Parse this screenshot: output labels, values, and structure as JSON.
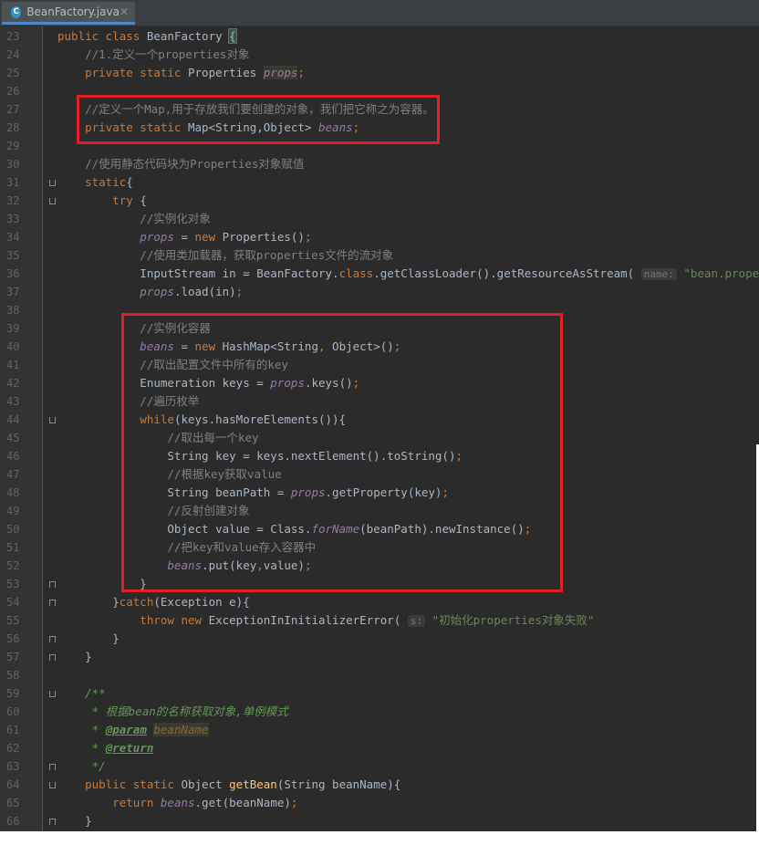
{
  "tab": {
    "icon": "C",
    "filename": "BeanFactory.java",
    "close": "✕"
  },
  "lines": [
    {
      "n": "23",
      "parts": [
        [
          "kw",
          "public class "
        ],
        [
          "",
          "BeanFactory "
        ],
        [
          "bh",
          "{"
        ]
      ]
    },
    {
      "n": "24",
      "parts": [
        [
          "cm",
          "    //1.定义一个properties对象"
        ]
      ]
    },
    {
      "n": "25",
      "parts": [
        [
          "kw",
          "    private static "
        ],
        [
          "",
          "Properties "
        ],
        [
          "fldu",
          "props"
        ],
        [
          "kw",
          ";"
        ]
      ]
    },
    {
      "n": "26",
      "parts": []
    },
    {
      "n": "27",
      "parts": [
        [
          "cm",
          "    //定义一个Map,用于存放我们要创建的对象，我们把它称之为容器。"
        ]
      ]
    },
    {
      "n": "28",
      "parts": [
        [
          "kw",
          "    private static "
        ],
        [
          "",
          "Map<String,Object> "
        ],
        [
          "fld",
          "beans"
        ],
        [
          "kw",
          ";"
        ]
      ]
    },
    {
      "n": "29",
      "parts": []
    },
    {
      "n": "30",
      "parts": [
        [
          "cm",
          "    //使用静态代码块为Properties对象赋值"
        ]
      ]
    },
    {
      "n": "31",
      "parts": [
        [
          "kw",
          "    static"
        ],
        [
          "",
          "{"
        ]
      ]
    },
    {
      "n": "32",
      "parts": [
        [
          "kw",
          "        try "
        ],
        [
          "",
          "{"
        ]
      ]
    },
    {
      "n": "33",
      "parts": [
        [
          "cm",
          "            //实例化对象"
        ]
      ]
    },
    {
      "n": "34",
      "parts": [
        [
          "fld",
          "            props"
        ],
        [
          "",
          " = "
        ],
        [
          "kw",
          "new "
        ],
        [
          "",
          "Properties()"
        ],
        [
          "kw",
          ";"
        ]
      ]
    },
    {
      "n": "35",
      "parts": [
        [
          "cm",
          "            //使用类加载器，获取properties文件的流对象"
        ]
      ]
    },
    {
      "n": "36",
      "parts": [
        [
          "",
          "            InputStream in = BeanFactory."
        ],
        [
          "kw",
          "class"
        ],
        [
          "",
          ".getClassLoader().getResourceAsStream( "
        ],
        [
          "hint",
          "name:"
        ],
        [
          "str",
          " \"bean.properties\""
        ],
        [
          "kw",
          ");"
        ]
      ]
    },
    {
      "n": "37",
      "parts": [
        [
          "fld",
          "            props"
        ],
        [
          "",
          ".load(in)"
        ],
        [
          "kw",
          ";"
        ]
      ]
    },
    {
      "n": "38",
      "parts": []
    },
    {
      "n": "39",
      "parts": [
        [
          "cm",
          "            //实例化容器"
        ]
      ]
    },
    {
      "n": "40",
      "parts": [
        [
          "fld",
          "            beans"
        ],
        [
          "",
          " = "
        ],
        [
          "kw",
          "new "
        ],
        [
          "",
          "HashMap<String"
        ],
        [
          "kw",
          ", "
        ],
        [
          "",
          "Object>()"
        ],
        [
          "kw",
          ";"
        ]
      ]
    },
    {
      "n": "41",
      "parts": [
        [
          "cm",
          "            //取出配置文件中所有的key"
        ]
      ]
    },
    {
      "n": "42",
      "parts": [
        [
          "",
          "            Enumeration keys = "
        ],
        [
          "fld",
          "props"
        ],
        [
          "",
          ".keys()"
        ],
        [
          "kw",
          ";"
        ]
      ]
    },
    {
      "n": "43",
      "parts": [
        [
          "cm",
          "            //遍历枚举"
        ]
      ]
    },
    {
      "n": "44",
      "parts": [
        [
          "kw",
          "            while"
        ],
        [
          "",
          "(keys.hasMoreElements()){"
        ]
      ]
    },
    {
      "n": "45",
      "parts": [
        [
          "cm",
          "                //取出每一个key"
        ]
      ]
    },
    {
      "n": "46",
      "parts": [
        [
          "",
          "                String key = keys.nextElement().toString()"
        ],
        [
          "kw",
          ";"
        ]
      ]
    },
    {
      "n": "47",
      "parts": [
        [
          "cm",
          "                //根据key获取value"
        ]
      ]
    },
    {
      "n": "48",
      "parts": [
        [
          "",
          "                String beanPath = "
        ],
        [
          "fld",
          "props"
        ],
        [
          "",
          ".getProperty(key)"
        ],
        [
          "kw",
          ";"
        ]
      ]
    },
    {
      "n": "49",
      "parts": [
        [
          "cm",
          "                //反射创建对象"
        ]
      ]
    },
    {
      "n": "50",
      "parts": [
        [
          "",
          "                Object value = Class."
        ],
        [
          "fld",
          "forName"
        ],
        [
          "",
          "(beanPath).newInstance()"
        ],
        [
          "kw",
          ";"
        ]
      ]
    },
    {
      "n": "51",
      "parts": [
        [
          "cm",
          "                //把key和value存入容器中"
        ]
      ]
    },
    {
      "n": "52",
      "parts": [
        [
          "fld",
          "                beans"
        ],
        [
          "",
          ".put(key"
        ],
        [
          "kw",
          ","
        ],
        [
          "",
          "value)"
        ],
        [
          "kw",
          ";"
        ]
      ]
    },
    {
      "n": "53",
      "parts": [
        [
          "",
          "            }"
        ]
      ]
    },
    {
      "n": "54",
      "parts": [
        [
          "",
          "        }"
        ],
        [
          "kw",
          "catch"
        ],
        [
          "",
          "(Exception e){"
        ]
      ]
    },
    {
      "n": "55",
      "parts": [
        [
          "kw",
          "            throw new "
        ],
        [
          "",
          "ExceptionInInitializerError( "
        ],
        [
          "hint",
          "s:"
        ],
        [
          "str",
          " \"初始化properties对象失败\""
        ]
      ]
    },
    {
      "n": "56",
      "parts": [
        [
          "",
          "        }"
        ]
      ]
    },
    {
      "n": "57",
      "parts": [
        [
          "",
          "    }"
        ]
      ]
    },
    {
      "n": "58",
      "parts": []
    },
    {
      "n": "59",
      "parts": [
        [
          "doc",
          "    /**"
        ]
      ]
    },
    {
      "n": "60",
      "parts": [
        [
          "doc",
          "     * 根据bean的名称获取对象,单例模式"
        ]
      ]
    },
    {
      "n": "61",
      "parts": [
        [
          "doc",
          "     * "
        ],
        [
          "tag",
          "@param"
        ],
        [
          "doc",
          " "
        ],
        [
          "param",
          "beanName"
        ]
      ]
    },
    {
      "n": "62",
      "parts": [
        [
          "doc",
          "     * "
        ],
        [
          "tag",
          "@return"
        ]
      ]
    },
    {
      "n": "63",
      "parts": [
        [
          "doc",
          "     */"
        ]
      ]
    },
    {
      "n": "64",
      "parts": [
        [
          "kw",
          "    public static "
        ],
        [
          "",
          "Object "
        ],
        [
          "mth",
          "getBean"
        ],
        [
          "",
          "(String beanName){"
        ]
      ]
    },
    {
      "n": "65",
      "parts": [
        [
          "kw",
          "        return "
        ],
        [
          "fld",
          "beans"
        ],
        [
          "",
          ".get(beanName)"
        ],
        [
          "kw",
          ";"
        ]
      ]
    },
    {
      "n": "66",
      "parts": [
        [
          "",
          "    }"
        ]
      ]
    }
  ],
  "colors": {
    "redbox": "#e01f26",
    "editor_bg": "#2b2b2b",
    "gutter_bg": "#313335",
    "tab_underline": "#4a88c7"
  }
}
